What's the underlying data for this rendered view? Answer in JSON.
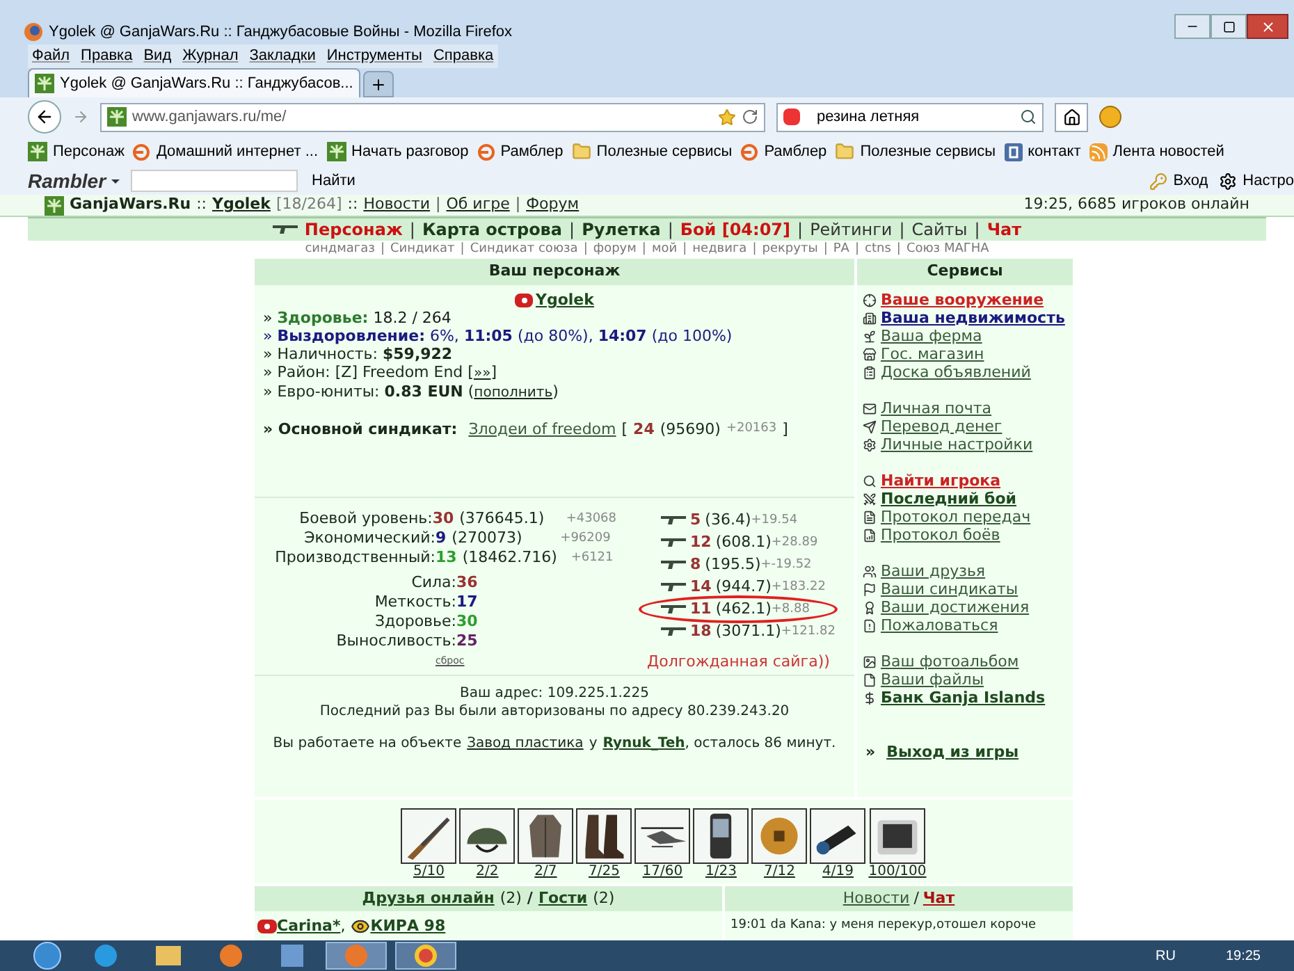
{
  "window": {
    "title": "Ygolek @ GanjaWars.Ru :: Ганджубасовые Войны - Mozilla Firefox"
  },
  "menu": [
    "Файл",
    "Правка",
    "Вид",
    "Журнал",
    "Закладки",
    "Инструменты",
    "Справка"
  ],
  "tabs": [
    {
      "label": "Ygolek @ GanjaWars.Ru :: Ганджубасов...",
      "selected": true
    }
  ],
  "address": {
    "value": "www.ganjawars.ru/me/"
  },
  "search": {
    "value": "резина летняя"
  },
  "bookmarks": [
    {
      "label": "Персонаж",
      "kind": "leaf"
    },
    {
      "label": "Домашний интернет ...",
      "kind": "rambler"
    },
    {
      "label": "Начать разговор",
      "kind": "leaf"
    },
    {
      "label": "Рамблер",
      "kind": "rambler"
    },
    {
      "label": "Полезные сервисы",
      "kind": "folder"
    },
    {
      "label": "Рамблер",
      "kind": "rambler"
    },
    {
      "label": "Полезные сервисы",
      "kind": "folder"
    },
    {
      "label": "контакт",
      "kind": "vk"
    },
    {
      "label": "Лента новостей",
      "kind": "rss"
    }
  ],
  "rambler_bar": {
    "logo": "Rambler",
    "find": "Найти",
    "login": "Вход",
    "settings": "Настро"
  },
  "site_header": {
    "brand": "GanjaWars.Ru",
    "sep": "::",
    "user": "Ygolek",
    "hp": "[18/264]",
    "sep2": "::",
    "link_sep": "|",
    "links": [
      "Новости",
      "Об игре",
      "Форум"
    ],
    "online": "19:25, 6685 игроков онлайн"
  },
  "main_nav_sep": "|",
  "main_nav": [
    {
      "label": "Персонаж",
      "kind": "current"
    },
    {
      "label": "Карта острова",
      "kind": "bold"
    },
    {
      "label": "Рулетка",
      "kind": "bold"
    },
    {
      "label": "Бой [04:07]",
      "kind": "red"
    },
    {
      "label": "Рейтинги",
      "kind": "plain"
    },
    {
      "label": "Сайты",
      "kind": "plain"
    },
    {
      "label": "Чат",
      "kind": "red"
    }
  ],
  "sub_nav_sep": "|",
  "sub_nav": [
    "синдмагаз",
    "Синдикат",
    "Синдикат союза",
    "форум",
    "мой",
    "недвига",
    "рекруты",
    "РА",
    "ctns",
    "Союз МАГНА"
  ],
  "character": {
    "title": "Ваш персонаж",
    "name": "Ygolek",
    "lines": [
      {
        "kind": "health",
        "text": "» **Здоровье:** 18.2 / 264"
      },
      {
        "kind": "recovery",
        "text": "» **Выздоровление:** 6%, **11:05** (до 80%), **14:07** (до 100%)"
      },
      {
        "kind": "plain",
        "text": "» Наличность: **$59,922**"
      },
      {
        "kind": "plain",
        "text": "» Район: [Z] Freedom End [",
        "link": "»»",
        "suffix": "]"
      },
      {
        "kind": "plain",
        "text": "» Евро-юниты: **0.83 EUN** (",
        "link": "пополнить",
        "suffix": ")"
      }
    ],
    "syndicate": {
      "label": "» Основной синдикат:",
      "name": "Злодеи of freedom",
      "open": "[",
      "level": "24",
      "exp": "(95690)",
      "gain": "+20163",
      "close": "]"
    }
  },
  "levels": [
    {
      "label": "Боевой уровень:",
      "value": "30",
      "color": "#993333",
      "exp": "(376645.1)",
      "gain": "+43068"
    },
    {
      "label": "Экономический:",
      "value": "9",
      "color": "#1a1a80",
      "exp": "(270073)",
      "gain": "+96209"
    },
    {
      "label": "Производственный:",
      "value": "13",
      "color": "#2e9e2e",
      "exp": "(18462.716)",
      "gain": "+6121"
    }
  ],
  "attributes": [
    {
      "label": "Сила:",
      "value": "36",
      "color": "#993333"
    },
    {
      "label": "Меткость:",
      "value": "17",
      "color": "#1a1a80"
    },
    {
      "label": "Здоровье:",
      "value": "30",
      "color": "#2e9e2e"
    },
    {
      "label": "Выносливость:",
      "value": "25",
      "color": "#662266"
    }
  ],
  "reset": "сброс",
  "weapons": [
    {
      "value": "5",
      "exp": "(36.4)",
      "gain": "+19.54",
      "circled": false
    },
    {
      "value": "12",
      "exp": "(608.1)",
      "gain": "+28.89",
      "circled": false
    },
    {
      "value": "8",
      "exp": "(195.5)",
      "gain": "+-19.52",
      "circled": false
    },
    {
      "value": "14",
      "exp": "(944.7)",
      "gain": "+183.22",
      "circled": false
    },
    {
      "value": "11",
      "exp": "(462.1)",
      "gain": "+8.88",
      "circled": true
    },
    {
      "value": "18",
      "exp": "(3071.1)",
      "gain": "+121.82",
      "circled": false
    }
  ],
  "note": "Долгожданная сайга))",
  "ip": "Ваш адрес: 109.225.1.225",
  "last_login": "Последний раз Вы были авторизованы по адресу 80.239.243.20",
  "work": {
    "prefix": "Вы работаете на объекте",
    "place": "Завод пластика",
    "mid": "у",
    "owner": "Rynuk_Teh",
    "suffix": ", осталось 86 минут."
  },
  "services": {
    "title": "Сервисы",
    "groups": [
      [
        {
          "label": "Ваше вооружение",
          "kind": "red"
        },
        {
          "label": "Ваша недвижимость",
          "kind": "navy"
        },
        {
          "label": "Ваша ферма",
          "kind": "plain"
        },
        {
          "label": "Гос. магазин",
          "kind": "plain"
        },
        {
          "label": "Доска объявлений",
          "kind": "plain"
        }
      ],
      [
        {
          "label": "Личная почта",
          "kind": "plain"
        },
        {
          "label": "Перевод денег",
          "kind": "plain"
        },
        {
          "label": "Личные настройки",
          "kind": "plain"
        }
      ],
      [
        {
          "label": "Найти игрока",
          "kind": "red"
        },
        {
          "label": "Последний бой",
          "kind": "bold"
        },
        {
          "label": "Протокол передач",
          "kind": "plain"
        },
        {
          "label": "Протокол боёв",
          "kind": "plain"
        }
      ],
      [
        {
          "label": "Ваши друзья",
          "kind": "plain"
        },
        {
          "label": "Ваши синдикаты",
          "kind": "plain"
        },
        {
          "label": "Ваши достижения",
          "kind": "plain"
        },
        {
          "label": "Пожаловаться",
          "kind": "plain"
        }
      ],
      [
        {
          "label": "Ваш фотоальбом",
          "kind": "plain"
        },
        {
          "label": "Ваши файлы",
          "kind": "plain"
        },
        {
          "label": "Банк Ganja Islands",
          "kind": "bold"
        }
      ]
    ],
    "exit_prefix": "»",
    "exit": "Выход из игры"
  },
  "items": [
    {
      "kind": "rifle",
      "count": "5/10"
    },
    {
      "kind": "helmet",
      "count": "2/2"
    },
    {
      "kind": "coat",
      "count": "2/7"
    },
    {
      "kind": "boots",
      "count": "7/25"
    },
    {
      "kind": "helicopter",
      "count": "17/60"
    },
    {
      "kind": "phone",
      "count": "1/23"
    },
    {
      "kind": "coin",
      "count": "7/12"
    },
    {
      "kind": "scope",
      "count": "4/19"
    },
    {
      "kind": "tablet",
      "count": "100/100"
    }
  ],
  "friends": {
    "title": "Друзья онлайн",
    "count": "(2)",
    "sep": "/",
    "guests": "Гости",
    "guests_count": "(2)",
    "list": [
      {
        "name": "Carina*",
        "kind": "online",
        "sep": ","
      },
      {
        "name": "КИРА 98",
        "kind": "watch"
      }
    ]
  },
  "news": {
    "title": "Новости",
    "sep": "/",
    "chat": "Чат",
    "message": "19:01 da Kana: у меня перекур,отошел короче"
  },
  "taskbar": {
    "lang": "RU",
    "time": "19:25"
  }
}
